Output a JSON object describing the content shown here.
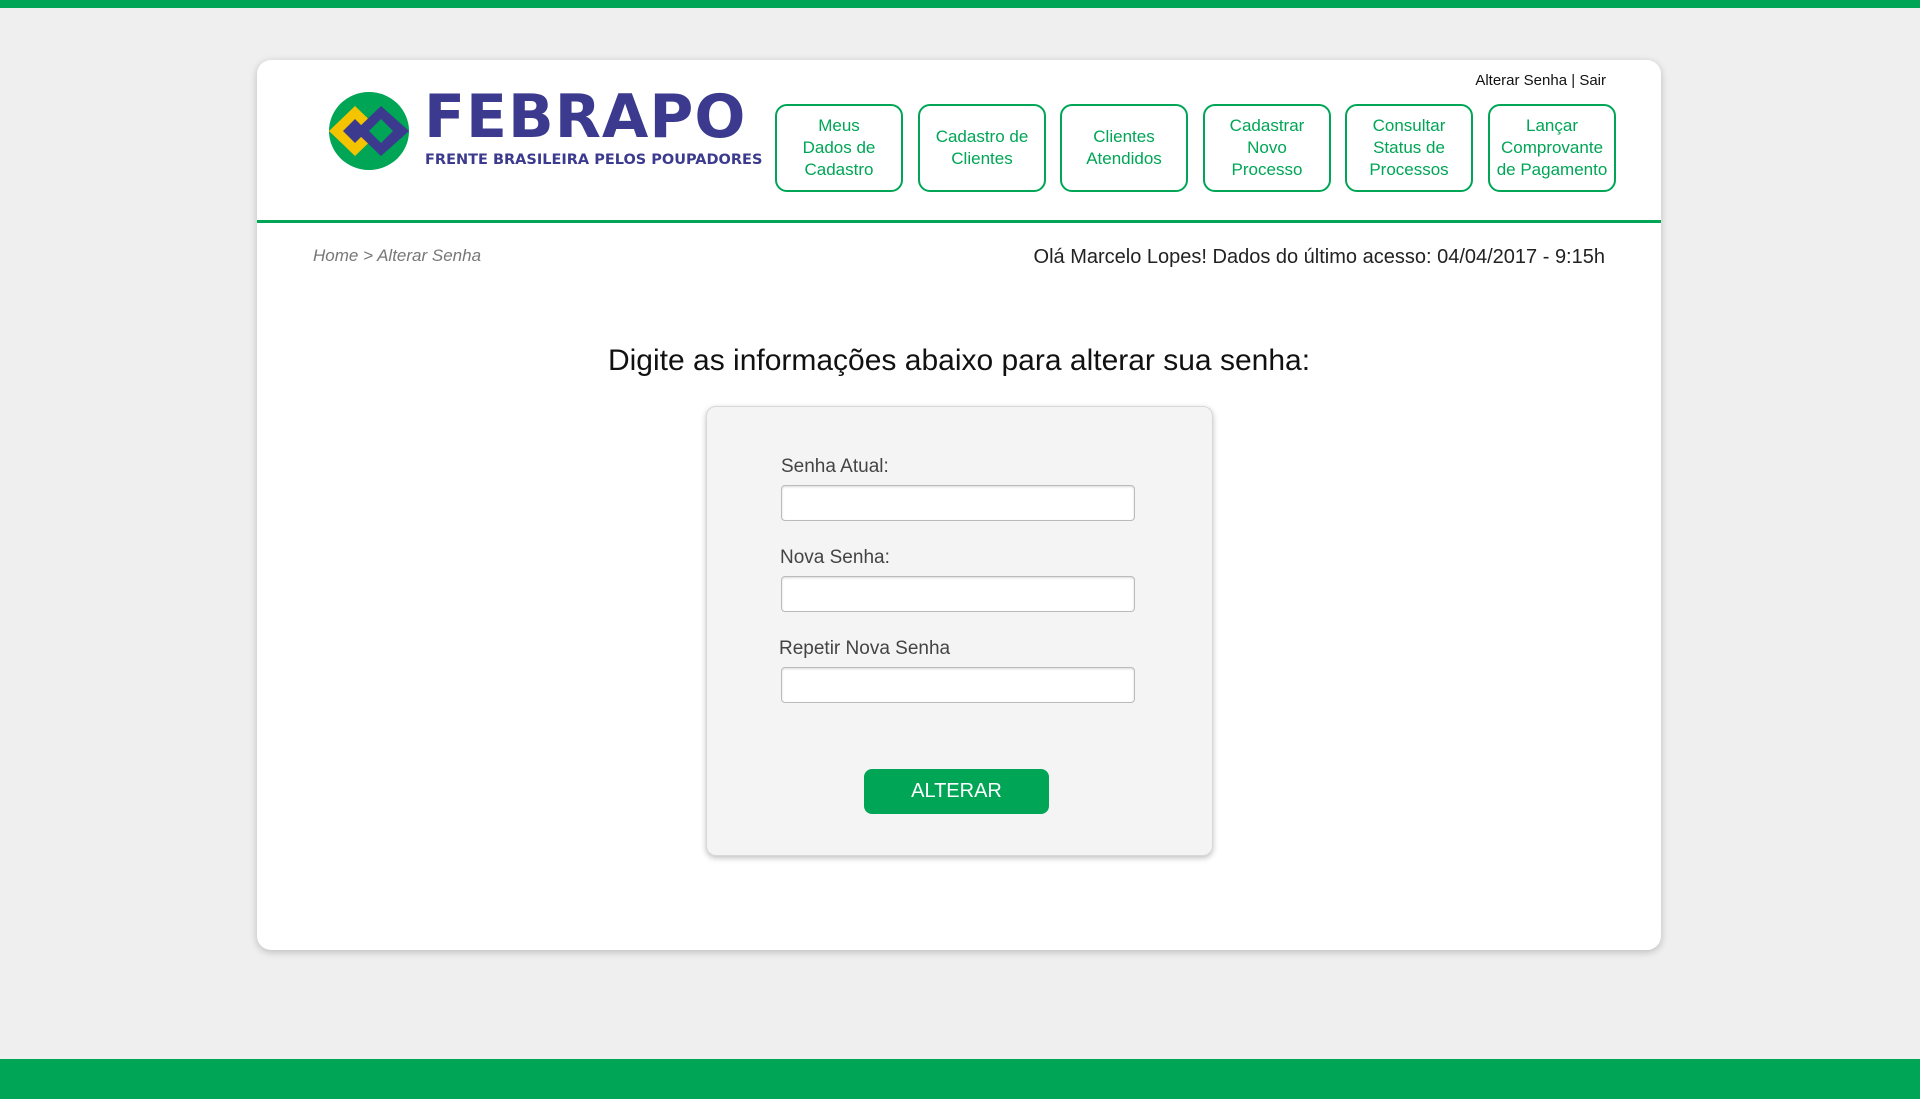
{
  "header": {
    "logo": {
      "wordmark": "FEBRAPO",
      "tagline": "FRENTE BRASILEIRA PELOS POUPADORES"
    },
    "top_links": {
      "change_password": "Alterar Senha",
      "separator": "|",
      "logout": "Sair"
    },
    "nav": [
      {
        "label": "Meus\nDados de\nCadastro"
      },
      {
        "label": "Cadastro de\nClientes"
      },
      {
        "label": "Clientes\nAtendidos"
      },
      {
        "label": "Cadastrar\nNovo\nProcesso"
      },
      {
        "label": "Consultar\nStatus de\nProcessos"
      },
      {
        "label": "Lançar\nComprovante\nde Pagamento"
      }
    ]
  },
  "breadcrumb": "Home > Alterar Senha",
  "greeting": "Olá Marcelo Lopes! Dados do último acesso: 04/04/2017 - 9:15h",
  "main": {
    "heading": "Digite as informações abaixo para alterar sua senha:",
    "form": {
      "current_password_label": "Senha Atual:",
      "current_password_value": "",
      "new_password_label": "Nova Senha:",
      "new_password_value": "",
      "repeat_password_label": "Repetir Nova Senha",
      "repeat_password_value": "",
      "submit_label": "ALTERAR"
    }
  },
  "colors": {
    "accent": "#00a556",
    "brand_blue": "#3b3a8f",
    "brand_yellow": "#f5c400",
    "background": "#efefef"
  }
}
